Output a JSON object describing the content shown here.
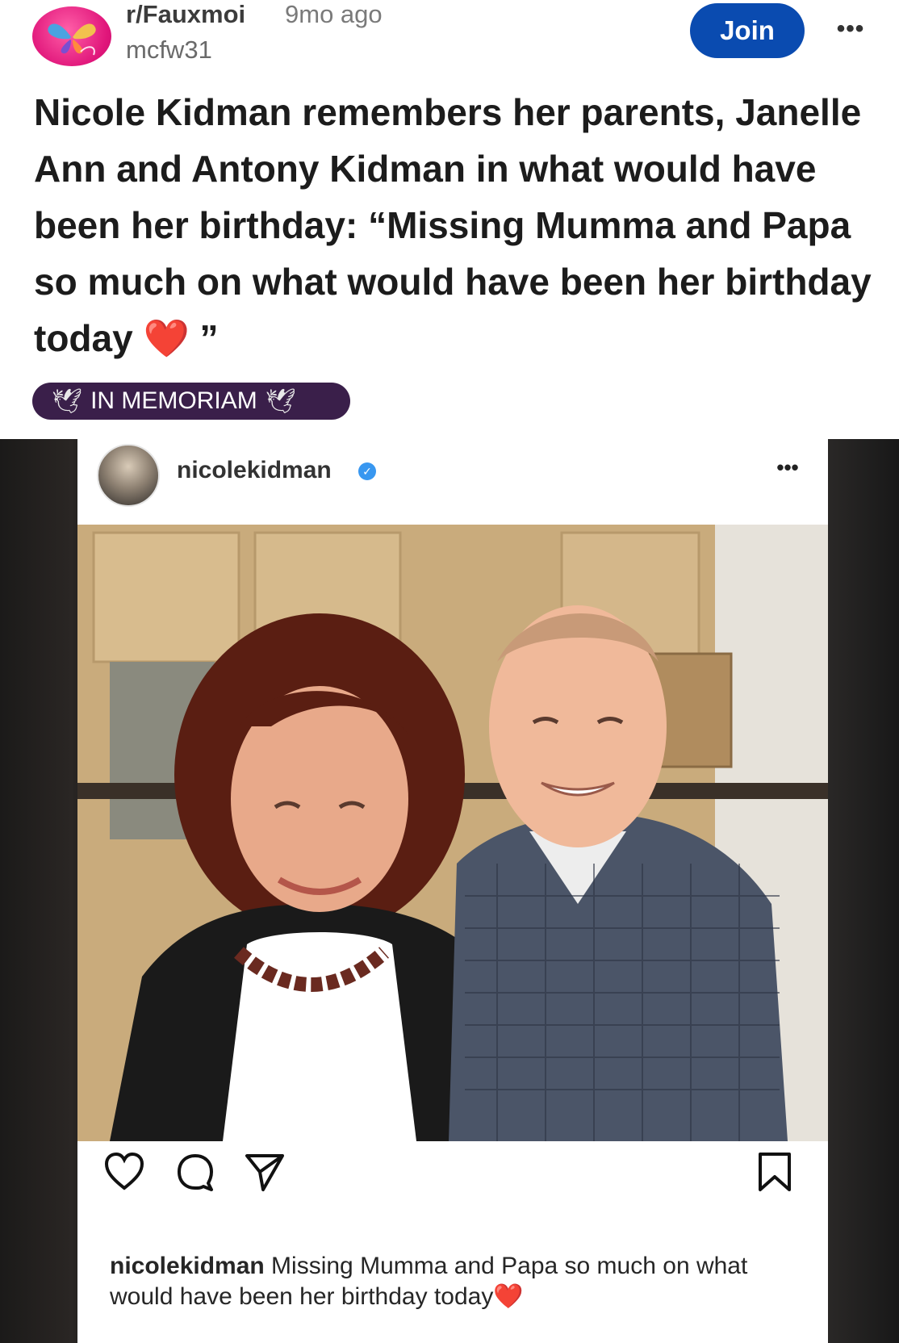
{
  "post": {
    "subreddit": "r/Fauxmoi",
    "age": "9mo ago",
    "author": "mcfw31",
    "join_label": "Join",
    "more_label": "•••",
    "title": "Nicole Kidman remembers her parents, Janelle Ann and Antony Kidman in what would have been her birthday: “Missing Mumma and Papa so much on what would have been her birthday today ",
    "title_heart": "❤️",
    "title_end": " ”",
    "flair": "IN MEMORIAM",
    "flair_icon": "🕊"
  },
  "instagram": {
    "username": "nicolekidman",
    "verified_mark": "✓",
    "more_label": "•••",
    "caption_user": "nicolekidman",
    "caption_text": " Missing Mumma and Papa so much on what would have been her birthday today",
    "caption_heart": "❤️",
    "icons": [
      "heart-icon",
      "comment-icon",
      "share-icon",
      "bookmark-icon"
    ]
  },
  "colors": {
    "join": "#0a4bb0",
    "flair_bg": "#3a1f4a",
    "subreddit_avatar": "#e0157a",
    "verified": "#3897f0"
  }
}
